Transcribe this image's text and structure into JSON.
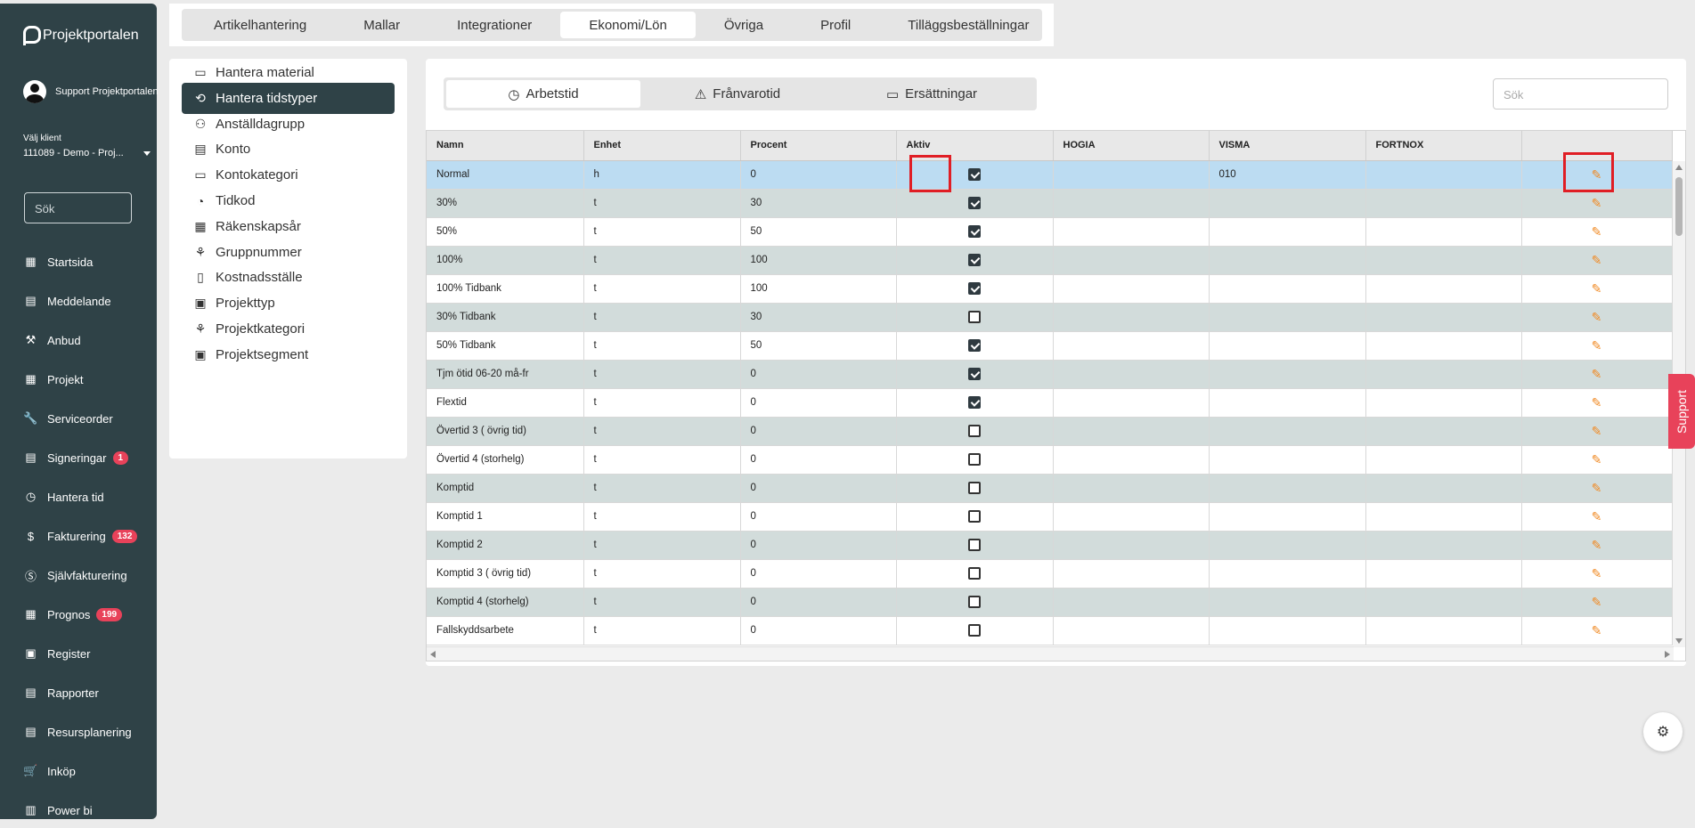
{
  "sidebar": {
    "brand": "Projektportalen",
    "user": "Support Projektportalen",
    "client_label": "Välj klient",
    "client_value": "111089 - Demo - Proj...",
    "search_placeholder": "Sök",
    "items": [
      {
        "label": "Startsida",
        "icon": "dashboard-icon",
        "glyph": "▦"
      },
      {
        "label": "Meddelande",
        "icon": "message-icon",
        "glyph": "▤"
      },
      {
        "label": "Anbud",
        "icon": "gavel-icon",
        "glyph": "⚒"
      },
      {
        "label": "Projekt",
        "icon": "grid-icon",
        "glyph": "▦"
      },
      {
        "label": "Serviceorder",
        "icon": "wrench-icon",
        "glyph": "🔧"
      },
      {
        "label": "Signeringar",
        "icon": "document-icon",
        "glyph": "▤",
        "badge": "1"
      },
      {
        "label": "Hantera tid",
        "icon": "clock-icon",
        "glyph": "◷"
      },
      {
        "label": "Fakturering",
        "icon": "dollar-icon",
        "glyph": "$",
        "badge": "132"
      },
      {
        "label": "Självfakturering",
        "icon": "dollar-circle-icon",
        "glyph": "Ⓢ"
      },
      {
        "label": "Prognos",
        "icon": "grid-icon",
        "glyph": "▦",
        "badge": "199"
      },
      {
        "label": "Register",
        "icon": "image-icon",
        "glyph": "▣"
      },
      {
        "label": "Rapporter",
        "icon": "calendar-icon",
        "glyph": "▤"
      },
      {
        "label": "Resursplanering",
        "icon": "calendar-icon",
        "glyph": "▤"
      },
      {
        "label": "Inköp",
        "icon": "cart-icon",
        "glyph": "🛒"
      },
      {
        "label": "Power bi",
        "icon": "chart-icon",
        "glyph": "▥"
      }
    ]
  },
  "top_tabs": [
    "Artikelhantering",
    "Mallar",
    "Integrationer",
    "Ekonomi/Lön",
    "Övriga",
    "Profil",
    "Tilläggsbeställningar"
  ],
  "top_tabs_active": "Ekonomi/Lön",
  "submenu": [
    {
      "label": "Hantera material",
      "icon": "archive-icon",
      "glyph": "▭"
    },
    {
      "label": "Hantera tidstyper",
      "icon": "time-type-icon",
      "glyph": "⟲"
    },
    {
      "label": "Anställdagrupp",
      "icon": "group-icon",
      "glyph": "⚇"
    },
    {
      "label": "Konto",
      "icon": "table-icon",
      "glyph": "▤"
    },
    {
      "label": "Kontokategori",
      "icon": "ticket-icon",
      "glyph": "▭"
    },
    {
      "label": "Tidkod",
      "icon": "clock-plus-icon",
      "glyph": "◔"
    },
    {
      "label": "Räkenskapsår",
      "icon": "calendar-icon",
      "glyph": "▦"
    },
    {
      "label": "Gruppnummer",
      "icon": "shapes-icon",
      "glyph": "⚘"
    },
    {
      "label": "Kostnadsställe",
      "icon": "receipt-icon",
      "glyph": "▯"
    },
    {
      "label": "Projekttyp",
      "icon": "money-icon",
      "glyph": "▣"
    },
    {
      "label": "Projektkategori",
      "icon": "category-icon",
      "glyph": "⚘"
    },
    {
      "label": "Projektsegment",
      "icon": "money-icon",
      "glyph": "▣"
    }
  ],
  "submenu_active": "Hantera tidstyper",
  "segments": [
    {
      "label": "Arbetstid",
      "icon": "clock-icon",
      "glyph": "◷"
    },
    {
      "label": "Frånvarotid",
      "icon": "warning-icon",
      "glyph": "⚠"
    },
    {
      "label": "Ersättningar",
      "icon": "card-icon",
      "glyph": "▭"
    }
  ],
  "segment_active": "Arbetstid",
  "search_placeholder": "Sök",
  "table": {
    "columns": [
      "Namn",
      "Enhet",
      "Procent",
      "Aktiv",
      "HOGIA",
      "VISMA",
      "FORTNOX",
      ""
    ],
    "rows": [
      {
        "namn": "Normal",
        "enhet": "h",
        "procent": "0",
        "aktiv": true,
        "hogia": "",
        "visma": "010",
        "fortnox": ""
      },
      {
        "namn": "30%",
        "enhet": "t",
        "procent": "30",
        "aktiv": true,
        "hogia": "",
        "visma": "",
        "fortnox": ""
      },
      {
        "namn": "50%",
        "enhet": "t",
        "procent": "50",
        "aktiv": true,
        "hogia": "",
        "visma": "",
        "fortnox": ""
      },
      {
        "namn": "100%",
        "enhet": "t",
        "procent": "100",
        "aktiv": true,
        "hogia": "",
        "visma": "",
        "fortnox": ""
      },
      {
        "namn": "100% Tidbank",
        "enhet": "t",
        "procent": "100",
        "aktiv": true,
        "hogia": "",
        "visma": "",
        "fortnox": ""
      },
      {
        "namn": "30% Tidbank",
        "enhet": "t",
        "procent": "30",
        "aktiv": false,
        "hogia": "",
        "visma": "",
        "fortnox": ""
      },
      {
        "namn": "50% Tidbank",
        "enhet": "t",
        "procent": "50",
        "aktiv": true,
        "hogia": "",
        "visma": "",
        "fortnox": ""
      },
      {
        "namn": "Tjm ötid 06-20 må-fr",
        "enhet": "t",
        "procent": "0",
        "aktiv": true,
        "hogia": "",
        "visma": "",
        "fortnox": ""
      },
      {
        "namn": "Flextid",
        "enhet": "t",
        "procent": "0",
        "aktiv": true,
        "hogia": "",
        "visma": "",
        "fortnox": ""
      },
      {
        "namn": "Övertid 3 ( övrig tid)",
        "enhet": "t",
        "procent": "0",
        "aktiv": false,
        "hogia": "",
        "visma": "",
        "fortnox": ""
      },
      {
        "namn": "Övertid 4 (storhelg)",
        "enhet": "t",
        "procent": "0",
        "aktiv": false,
        "hogia": "",
        "visma": "",
        "fortnox": ""
      },
      {
        "namn": "Komptid",
        "enhet": "t",
        "procent": "0",
        "aktiv": false,
        "hogia": "",
        "visma": "",
        "fortnox": ""
      },
      {
        "namn": "Komptid 1",
        "enhet": "t",
        "procent": "0",
        "aktiv": false,
        "hogia": "",
        "visma": "",
        "fortnox": ""
      },
      {
        "namn": "Komptid 2",
        "enhet": "t",
        "procent": "0",
        "aktiv": false,
        "hogia": "",
        "visma": "",
        "fortnox": ""
      },
      {
        "namn": "Komptid 3 ( övrig tid)",
        "enhet": "t",
        "procent": "0",
        "aktiv": false,
        "hogia": "",
        "visma": "",
        "fortnox": ""
      },
      {
        "namn": "Komptid 4 (storhelg)",
        "enhet": "t",
        "procent": "0",
        "aktiv": false,
        "hogia": "",
        "visma": "",
        "fortnox": ""
      },
      {
        "namn": "Fallskyddsarbete",
        "enhet": "t",
        "procent": "0",
        "aktiv": false,
        "hogia": "",
        "visma": "",
        "fortnox": ""
      }
    ]
  },
  "support_label": "Support",
  "colors": {
    "accent": "#2f4247",
    "badge": "#e8425a",
    "edit": "#f08a24",
    "highlight": "#e01e25"
  }
}
